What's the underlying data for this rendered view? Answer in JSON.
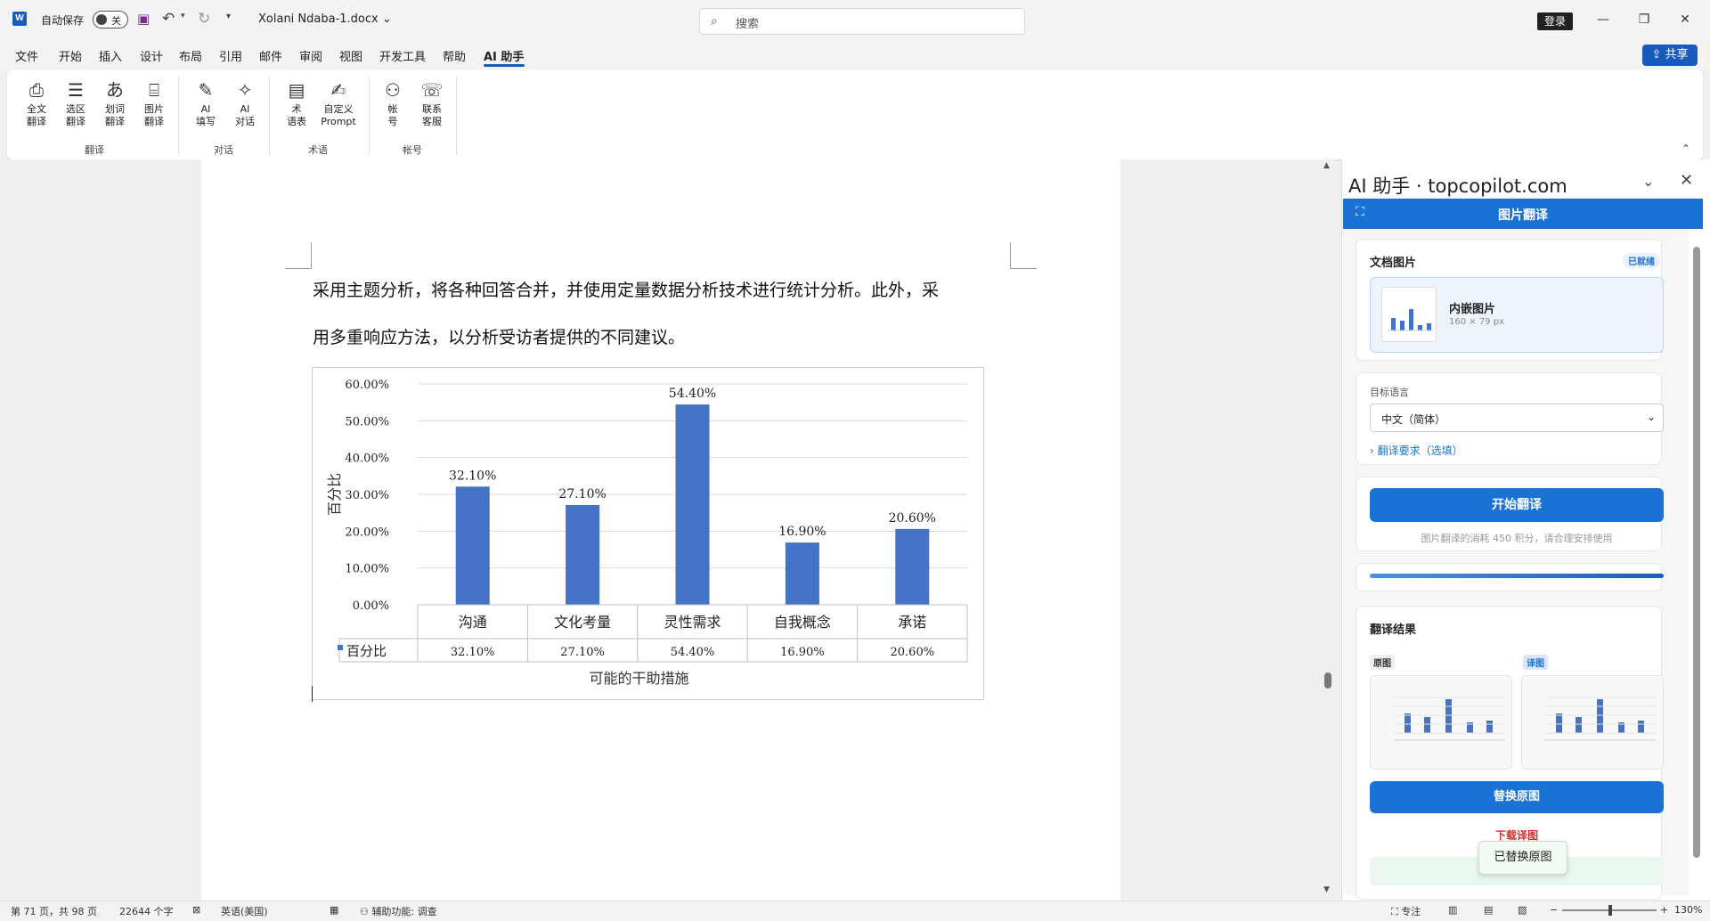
{
  "titlebar": {
    "autosave_label": "自动保存",
    "autosave_state": "关",
    "doc_title": "Xolani Ndaba-1.docx",
    "search_placeholder": "搜索",
    "login_label": "登录"
  },
  "menu_tabs": [
    "文件",
    "开始",
    "插入",
    "设计",
    "布局",
    "引用",
    "邮件",
    "审阅",
    "视图",
    "开发工具",
    "帮助",
    "AI 助手"
  ],
  "share_label": "共享",
  "ribbon": {
    "buttons": [
      {
        "l1": "全文",
        "l2": "翻译",
        "icon": "document-translate-icon"
      },
      {
        "l1": "选区",
        "l2": "翻译",
        "icon": "selection-translate-icon"
      },
      {
        "l1": "划词",
        "l2": "翻译",
        "icon": "word-translate-icon"
      },
      {
        "l1": "图片",
        "l2": "翻译",
        "icon": "image-translate-icon"
      },
      {
        "l1": "AI",
        "l2": "填写",
        "icon": "ai-fill-icon"
      },
      {
        "l1": "AI",
        "l2": "对话",
        "icon": "ai-chat-icon"
      },
      {
        "l1": "术",
        "l2": "语表",
        "icon": "glossary-icon"
      },
      {
        "l1": "自定义",
        "l2": "Prompt",
        "icon": "custom-prompt-icon"
      },
      {
        "l1": "帐",
        "l2": "号",
        "icon": "account-icon"
      },
      {
        "l1": "联系",
        "l2": "客服",
        "icon": "support-icon"
      }
    ],
    "groups": [
      "翻译",
      "对话",
      "术语",
      "帐号"
    ]
  },
  "document": {
    "paragraph_line1": "采用主题分析，将各种回答合并，并使用定量数据分析技术进行统计分析。此外，采",
    "paragraph_line2": "用多重响应方法，以分析受访者提供的不同建议。"
  },
  "chart_data": {
    "type": "bar",
    "categories": [
      "沟通",
      "文化考量",
      "灵性需求",
      "自我概念",
      "承诺"
    ],
    "values": [
      32.1,
      27.1,
      54.4,
      16.9,
      20.6
    ],
    "value_labels": [
      "32.10%",
      "27.10%",
      "54.40%",
      "16.90%",
      "20.60%"
    ],
    "series_name": "百分比",
    "ylabel": "百分比",
    "xlabel": "可能的干助措施",
    "ylim": [
      0,
      60
    ],
    "yticks": [
      "0.00%",
      "10.00%",
      "20.00%",
      "30.00%",
      "40.00%",
      "50.00%",
      "60.00%"
    ],
    "grid": true,
    "data_table": true,
    "bar_color": "#4472c4"
  },
  "panel": {
    "title": "AI 助手 · topcopilot.com",
    "header": "图片翻译",
    "doc_images_title": "文档图片",
    "ready_badge": "已就绪",
    "embed_name": "内嵌图片",
    "embed_size": "160 × 79 px",
    "lang_label": "目标语言",
    "lang_value": "中文（简体）",
    "req_link": "翻译要求（选填）",
    "start_btn": "开始翻译",
    "cost_note": "图片翻译的消耗 450 积分，请合理安排使用",
    "progress": 1.0,
    "result_title": "翻译结果",
    "orig_tag": "原图",
    "trans_tag": "译图",
    "replace_btn": "替换原图",
    "download_link": "下载译图",
    "toast": "已替换原图"
  },
  "status": {
    "page": "第 71 页，共 98 页",
    "words": "22644 个字",
    "language": "英语(美国)",
    "accessibility": "辅助功能: 调查",
    "focus": "专注",
    "zoom": "130%"
  },
  "colors": {
    "accent": "#185abd",
    "panel_blue": "#1a73d4",
    "bar": "#4472c4"
  }
}
